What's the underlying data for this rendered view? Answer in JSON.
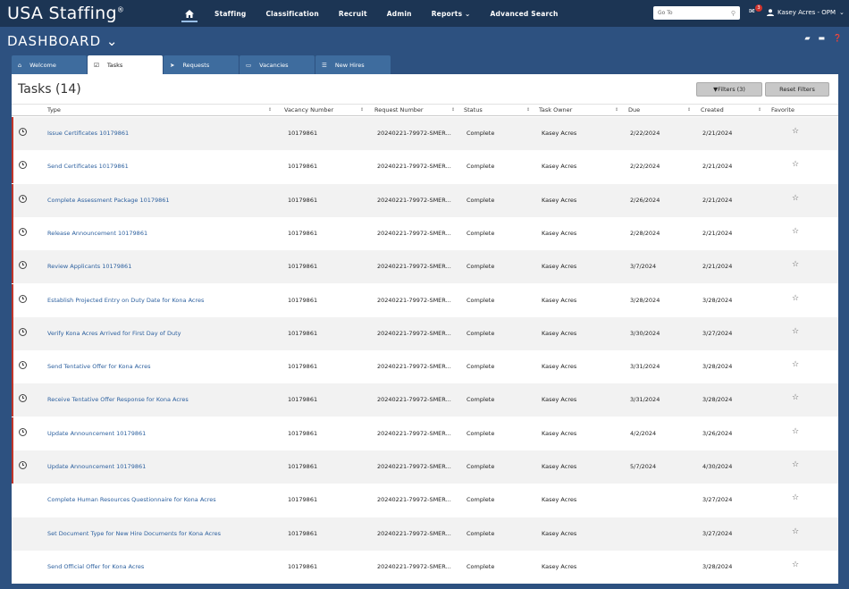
{
  "brand": {
    "name": "USA Staffing",
    "mark": "®"
  },
  "nav": [
    {
      "label": "Staffing"
    },
    {
      "label": "Classification"
    },
    {
      "label": "Recruit"
    },
    {
      "label": "Admin"
    },
    {
      "label": "Reports ⌄"
    },
    {
      "label": "Advanced Search"
    }
  ],
  "goto": {
    "placeholder": "Go To"
  },
  "mail": {
    "count": "3"
  },
  "user": {
    "name": "Kasey Acres - OPM"
  },
  "dashboard": {
    "title": "DASHBOARD ⌄"
  },
  "tabs": [
    {
      "label": "Welcome",
      "icon": "home-icon"
    },
    {
      "label": "Tasks",
      "icon": "checkbox-icon"
    },
    {
      "label": "Requests",
      "icon": "send-icon"
    },
    {
      "label": "Vacancies",
      "icon": "folder-icon"
    },
    {
      "label": "New Hires",
      "icon": "people-icon"
    }
  ],
  "panel": {
    "title": "Tasks (14)",
    "filters_label": "Filters (3)",
    "reset_label": "Reset Filters"
  },
  "columns": [
    "Type",
    "Vacancy Number",
    "Request Number",
    "Status",
    "Task Owner",
    "Due",
    "Created",
    "Favorite"
  ],
  "rows": [
    {
      "type": "Issue Certificates 10179861",
      "vacancy": "10179861",
      "request": "20240221-79972-SMER...",
      "status": "Complete",
      "owner": "Kasey Acres",
      "due": "2/22/2024",
      "created": "2/21/2024",
      "flag": true
    },
    {
      "type": "Send Certificates 10179861",
      "vacancy": "10179861",
      "request": "20240221-79972-SMER...",
      "status": "Complete",
      "owner": "Kasey Acres",
      "due": "2/22/2024",
      "created": "2/21/2024",
      "flag": true
    },
    {
      "type": "Complete Assessment Package 10179861",
      "vacancy": "10179861",
      "request": "20240221-79972-SMER...",
      "status": "Complete",
      "owner": "Kasey Acres",
      "due": "2/26/2024",
      "created": "2/21/2024",
      "flag": true
    },
    {
      "type": "Release Announcement 10179861",
      "vacancy": "10179861",
      "request": "20240221-79972-SMER...",
      "status": "Complete",
      "owner": "Kasey Acres",
      "due": "2/28/2024",
      "created": "2/21/2024",
      "flag": true
    },
    {
      "type": "Review Applicants 10179861",
      "vacancy": "10179861",
      "request": "20240221-79972-SMER...",
      "status": "Complete",
      "owner": "Kasey Acres",
      "due": "3/7/2024",
      "created": "2/21/2024",
      "flag": true
    },
    {
      "type": "Establish Projected Entry on Duty Date for Kona Acres",
      "vacancy": "10179861",
      "request": "20240221-79972-SMER...",
      "status": "Complete",
      "owner": "Kasey Acres",
      "due": "3/28/2024",
      "created": "3/28/2024",
      "flag": true
    },
    {
      "type": "Verify Kona Acres Arrived for First Day of Duty",
      "vacancy": "10179861",
      "request": "20240221-79972-SMER...",
      "status": "Complete",
      "owner": "Kasey Acres",
      "due": "3/30/2024",
      "created": "3/27/2024",
      "flag": true
    },
    {
      "type": "Send Tentative Offer for Kona Acres",
      "vacancy": "10179861",
      "request": "20240221-79972-SMER...",
      "status": "Complete",
      "owner": "Kasey Acres",
      "due": "3/31/2024",
      "created": "3/28/2024",
      "flag": true
    },
    {
      "type": "Receive Tentative Offer Response for Kona Acres",
      "vacancy": "10179861",
      "request": "20240221-79972-SMER...",
      "status": "Complete",
      "owner": "Kasey Acres",
      "due": "3/31/2024",
      "created": "3/28/2024",
      "flag": true
    },
    {
      "type": "Update Announcement 10179861",
      "vacancy": "10179861",
      "request": "20240221-79972-SMER...",
      "status": "Complete",
      "owner": "Kasey Acres",
      "due": "4/2/2024",
      "created": "3/26/2024",
      "flag": true
    },
    {
      "type": "Update Announcement 10179861",
      "vacancy": "10179861",
      "request": "20240221-79972-SMER...",
      "status": "Complete",
      "owner": "Kasey Acres",
      "due": "5/7/2024",
      "created": "4/30/2024",
      "flag": true
    },
    {
      "type": "Complete Human Resources Questionnaire for Kona Acres",
      "vacancy": "10179861",
      "request": "20240221-79972-SMER...",
      "status": "Complete",
      "owner": "Kasey Acres",
      "due": "",
      "created": "3/27/2024",
      "flag": false
    },
    {
      "type": "Set Document Type for New Hire Documents for Kona Acres",
      "vacancy": "10179861",
      "request": "20240221-79972-SMER...",
      "status": "Complete",
      "owner": "Kasey Acres",
      "due": "",
      "created": "3/27/2024",
      "flag": false
    },
    {
      "type": "Send Official Offer for Kona Acres",
      "vacancy": "10179861",
      "request": "20240221-79972-SMER...",
      "status": "Complete",
      "owner": "Kasey Acres",
      "due": "",
      "created": "3/28/2024",
      "flag": false
    }
  ]
}
